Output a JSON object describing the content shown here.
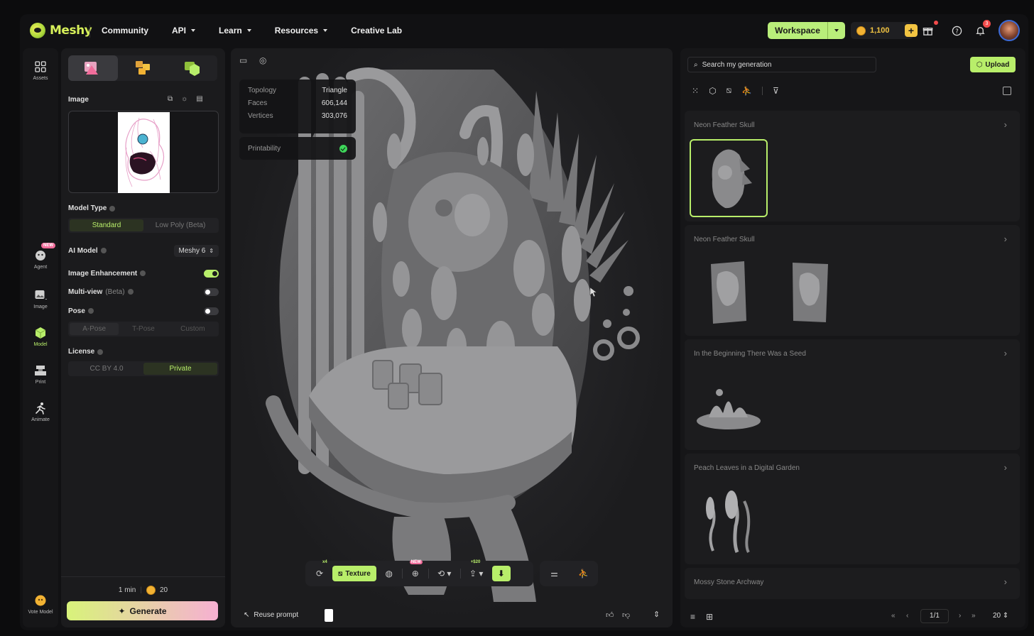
{
  "brand": {
    "name": "Meshy"
  },
  "nav": [
    {
      "label": "Community",
      "has_menu": false
    },
    {
      "label": "API",
      "has_menu": true
    },
    {
      "label": "Learn",
      "has_menu": true
    },
    {
      "label": "Resources",
      "has_menu": true
    },
    {
      "label": "Creative Lab",
      "has_menu": false
    }
  ],
  "header": {
    "workspace_label": "Workspace",
    "credits": "1,100",
    "notifications_count": "3",
    "icons": [
      "gift-icon",
      "help-icon",
      "bell-icon"
    ]
  },
  "rail": {
    "items": [
      {
        "label": "Assets",
        "icon": "grid-icon"
      },
      {
        "label": "Agent",
        "icon": "agent-icon",
        "badge": "NEW"
      },
      {
        "label": "Image",
        "icon": "image-icon"
      },
      {
        "label": "Model",
        "icon": "cube-icon"
      },
      {
        "label": "Print",
        "icon": "print-icon"
      },
      {
        "label": "Animate",
        "icon": "run-icon"
      }
    ],
    "vote_label": "Vote Model"
  },
  "panel": {
    "image_label": "Image",
    "model_type_label": "Model Type",
    "model_types": [
      "Standard",
      "Low Poly (Beta)"
    ],
    "model_type_selected": 0,
    "ai_model_label": "AI Model",
    "ai_model_value": "Meshy 6",
    "image_enhancement_label": "Image Enhancement",
    "image_enhancement_on": true,
    "multiview_label": "Multi-view",
    "multiview_beta": "(Beta)",
    "multiview_on": false,
    "pose_label": "Pose",
    "pose_on": false,
    "pose_options": [
      "A-Pose",
      "T-Pose",
      "Custom"
    ],
    "pose_selected": 0,
    "license_label": "License",
    "license_options": [
      "CC BY 4.0",
      "Private"
    ],
    "license_selected": 1,
    "time": "1 min",
    "cost": "20",
    "generate_label": "Generate"
  },
  "viewport": {
    "topology_label": "Topology",
    "topology_value": "Triangle",
    "faces_label": "Faces",
    "faces_value": "606,144",
    "vertices_label": "Vertices",
    "vertices_value": "303,076",
    "printability_label": "Printability",
    "toolbar": {
      "retry_badge": "x4",
      "texture_label": "Texture",
      "new_badge": "NEW",
      "cost_badge": "+$20"
    },
    "reuse_label": "Reuse prompt"
  },
  "gallery": {
    "search_placeholder": "Search my generation",
    "upload_label": "Upload",
    "cards": [
      {
        "title": "Neon Feather Skull",
        "thumbs": 1
      },
      {
        "title": "Neon Feather Skull",
        "thumbs": 2
      },
      {
        "title": "In the Beginning There Was a Seed",
        "thumbs": 1
      },
      {
        "title": "Peach Leaves in a Digital Garden",
        "thumbs": 1
      },
      {
        "title": "Mossy Stone Archway",
        "thumbs": 0
      }
    ],
    "page": "1/1",
    "per_page": "20"
  },
  "colors": {
    "accent": "#b8ee6a",
    "coin": "#f2b233",
    "badge": "#f16d9b"
  }
}
